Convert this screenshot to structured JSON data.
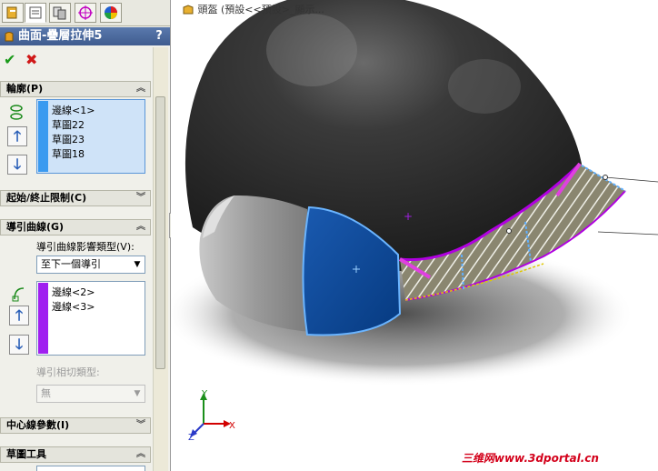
{
  "feature": {
    "title": "曲面-疊層拉伸5",
    "help": "?"
  },
  "actions": {
    "ok": "✔",
    "cancel": "✖"
  },
  "sections": {
    "profile": {
      "title": "輪廓(P)",
      "items": [
        "邊線<1>",
        "草圖22",
        "草圖23",
        "草圖18"
      ]
    },
    "start_end": {
      "title": "起始/終止限制(C)"
    },
    "guides": {
      "title": "導引曲線(G)",
      "influence_label": "導引曲線影響類型(V):",
      "influence_value": "至下一個導引",
      "items": [
        "邊線<2>",
        "邊線<3>"
      ],
      "tangency_label": "導引相切類型:",
      "tangency_value": "無"
    },
    "centerline": {
      "title": "中心線參數(I)"
    },
    "sketch_tools": {
      "title": "草圖工具"
    }
  },
  "viewport": {
    "breadcrumb": "頭盔 (預設<<預設>_顯示...",
    "watermark": "三维网www.3dportal.cn",
    "axes": {
      "x": "X",
      "y": "Y",
      "z": "Z"
    }
  },
  "colors": {
    "title_bar": "#4a6ba0",
    "helmet": "#2b2b2b",
    "blue_face": "#0a4a9a",
    "magenta": "#b000e0"
  }
}
